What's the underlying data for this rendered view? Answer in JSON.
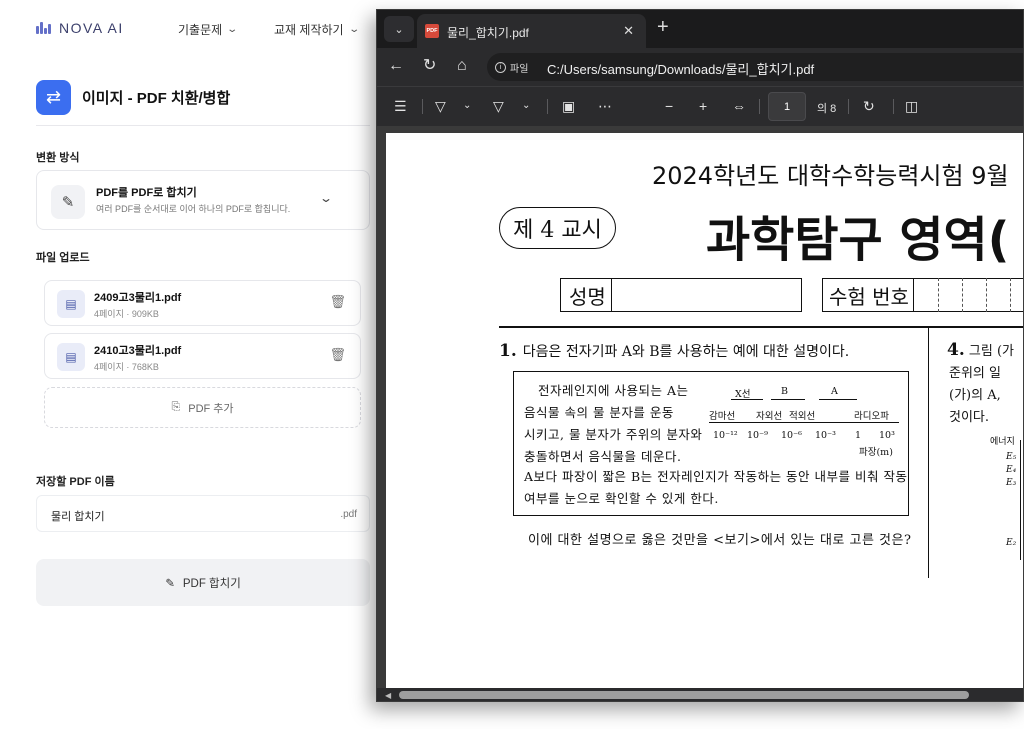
{
  "app": {
    "logo_text": "NOVA AI",
    "nav": [
      {
        "label": "기출문제"
      },
      {
        "label": "교재 제작하기"
      }
    ],
    "page_title": "이미지 - PDF 치환/병합",
    "accent_color": "#3b6ef0",
    "method_section_label": "변환 방식",
    "method": {
      "title": "PDF를 PDF로 합치기",
      "description": "여러 PDF를 순서대로 이어 하나의 PDF로 합칩니다."
    },
    "upload_section_label": "파일 업로드",
    "files": [
      {
        "name": "2409고3물리1.pdf",
        "meta": "4페이지 · 909KB"
      },
      {
        "name": "2410고3물리1.pdf",
        "meta": "4페이지 · 768KB"
      }
    ],
    "add_pdf_label": "PDF 추가",
    "save_name_label": "저장할 PDF 이름",
    "save_name_value": "물리 합치기",
    "save_name_ext": ".pdf",
    "merge_button_label": "PDF 합치기"
  },
  "viewer": {
    "tab_title": "물리_합치기.pdf",
    "url_scheme_label": "파일",
    "url": "C:/Users/samsung/Downloads/물리_합치기.pdf",
    "page_number": "1",
    "page_total": "의 8",
    "document": {
      "exam_header": "2024학년도 대학수학능력시험 9월",
      "period": "제 4 교시",
      "title": "과학탐구 영역(",
      "name_label": "성명",
      "exam_no_label": "수험 번호",
      "q1_number": "1.",
      "q1_stem": "다음은 전자기파 A와 B를 사용하는 예에 대한 설명이다.",
      "q1_box_lines": [
        "전자레인지에 사용되는 A는",
        "음식물 속의 물 분자를 운동",
        "시키고, 물 분자가 주위의 분자와",
        "충돌하면서 음식물을 데운다."
      ],
      "q1_box_bottom": "A보다 파장이 짧은 B는 전자레인지가 작동하는 동안 내부를 비춰 작동 여부를 눈으로 확인할 수 있게 한다.",
      "spectrum": {
        "bands_top": [
          "X선",
          "B",
          "A"
        ],
        "bands_bottom": [
          "감마선",
          "자외선",
          "적외선",
          "라디오파"
        ],
        "ticks": [
          "10⁻¹²",
          "10⁻⁹",
          "10⁻⁶",
          "10⁻³",
          "1",
          "10³"
        ],
        "axis_unit": "파장(m)"
      },
      "q1_ask": "이에 대한 설명으로 옳은 것만을 <보기>에서 있는 대로 고른 것은?",
      "q4_number": "4.",
      "q4_lines": [
        "그림 (가",
        "준위의 일",
        "(가)의 A,",
        "것이다."
      ],
      "q4_energy_label": "에너지",
      "q4_levels": [
        "E₅",
        "E₄",
        "E₃",
        "E₂"
      ]
    }
  }
}
